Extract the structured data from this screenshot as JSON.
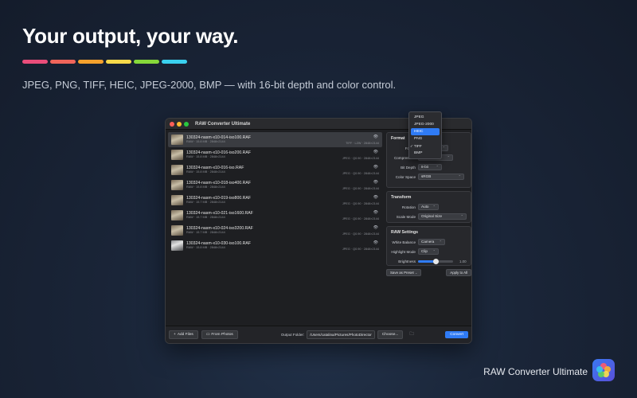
{
  "hero": {
    "title": "Your output, your way.",
    "subtitle": "JPEG, PNG, TIFF, HEIC, JPEG-2000, BMP — with 16-bit depth and color control.",
    "stripe_colors": [
      "#ea4d7a",
      "#f0655a",
      "#f5a12c",
      "#f7d94a",
      "#86d83a",
      "#3ad1ef"
    ]
  },
  "window": {
    "title": "RAW Converter Ultimate",
    "traffic_lights": [
      "#ff5f57",
      "#febc2e",
      "#28c840"
    ]
  },
  "files": [
    {
      "name": "130324-nasm-x10-014-iso100.RAF",
      "meta": "RAW · 15.8 MB · 2848×2144",
      "output": "TIFF · LZW · 2848×2144",
      "selected": true
    },
    {
      "name": "130324-nasm-x10-016-iso200.RAF",
      "meta": "RAW · 15.8 MB · 2848×2144",
      "output": "JPEG · Q0.90 · 2848×2144"
    },
    {
      "name": "130324-nasm-x10-016-iso.RAF",
      "meta": "RAW · 15.8 MB · 2848×2144",
      "output": "JPEG · Q0.90 · 2848×2144"
    },
    {
      "name": "130324-nasm-x10-018-iso400.RAF",
      "meta": "RAW · 15.8 MB · 2848×2144",
      "output": "JPEG · Q0.90 · 2848×2144"
    },
    {
      "name": "130324-nasm-x10-019-iso800.RAF",
      "meta": "RAW · 15.7 MB · 2848×2144",
      "output": "JPEG · Q0.90 · 2848×2144"
    },
    {
      "name": "130324-nasm-x10-021-iso1600.RAF",
      "meta": "RAW · 15.7 MB · 2848×2144",
      "output": "JPEG · Q0.90 · 2848×2144"
    },
    {
      "name": "130324-nasm-x10-024-iso3200.RAF",
      "meta": "RAW · 15.7 MB · 2848×2144",
      "output": "JPEG · Q0.90 · 2848×2144"
    },
    {
      "name": "130324-nasm-x10-030-iso100.RAF",
      "meta": "RAW · 15.8 MB · 2848×2144",
      "output": "JPEG · Q0.90 · 2848×2144"
    }
  ],
  "format_panel": {
    "title": "Format",
    "format_label": "Forma",
    "format_value": "TIFF",
    "compression_label": "Compression",
    "compression_value": "",
    "bit_depth_label": "Bit Depth",
    "bit_depth_value": "8-bit",
    "color_space_label": "Color Space",
    "color_space_value": "sRGB"
  },
  "format_dropdown": {
    "options": [
      "JPEG",
      "JPEG-2000",
      "HEIC",
      "PNG",
      "TIFF",
      "BMP"
    ],
    "highlighted": "HEIC",
    "checked": "TIFF"
  },
  "transform_panel": {
    "title": "Transform",
    "rotation_label": "Rotation",
    "rotation_value": "Auto",
    "scale_mode_label": "Scale Mode",
    "scale_mode_value": "Original Size"
  },
  "raw_panel": {
    "title": "RAW Settings",
    "white_balance_label": "White Balance",
    "white_balance_value": "Camera",
    "highlight_mode_label": "Highlight Mode",
    "highlight_mode_value": "Clip",
    "brightness_label": "Brightness",
    "brightness_value": "1.00",
    "brightness_level": 0.5
  },
  "presets": {
    "save_label": "Save as Preset",
    "apply_label": "Apply to All"
  },
  "bottom": {
    "add_files": "Add Files",
    "from_photos": "From Photos",
    "output_folder_label": "Output Folder:",
    "output_folder_path": "/Users/catalina/Pictures/PhotoDirector",
    "choose": "Choose...",
    "convert": "Convert"
  },
  "brand": {
    "name": "RAW Converter Ultimate",
    "icon_color": "#3a78f2"
  }
}
